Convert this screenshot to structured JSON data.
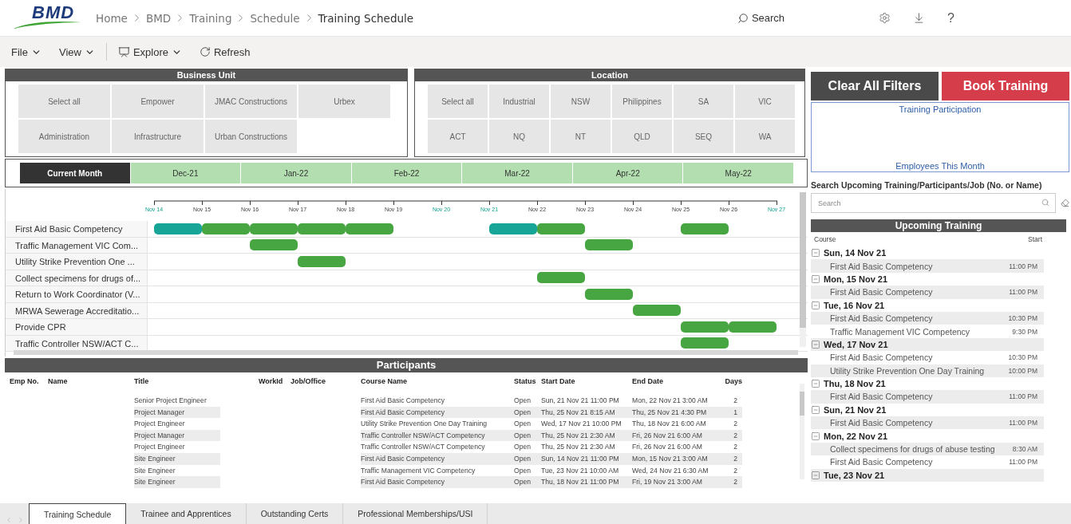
{
  "header": {
    "logo": "BMD",
    "breadcrumb": [
      "Home",
      "BMD",
      "Training",
      "Schedule",
      "Training Schedule"
    ],
    "search": "Search",
    "help": "?"
  },
  "toolbar": {
    "items": [
      "File",
      "View"
    ],
    "explore": "Explore",
    "refresh": "Refresh"
  },
  "business_unit": {
    "title": "Business Unit",
    "options": [
      {
        "label": "Select all",
        "selected": false
      },
      {
        "label": "Empower",
        "selected": false
      },
      {
        "label": "JMAC Constructions",
        "selected": false
      },
      {
        "label": "Urbex",
        "selected": false
      },
      {
        "label": "Administration",
        "selected": false
      },
      {
        "label": "Infrastructure",
        "selected": false
      },
      {
        "label": "Urban Constructions",
        "selected": false
      }
    ]
  },
  "location": {
    "title": "Location",
    "options": [
      {
        "label": "Select all",
        "selected": false
      },
      {
        "label": "Industrial",
        "selected": false
      },
      {
        "label": "NSW",
        "selected": false
      },
      {
        "label": "Philippines",
        "selected": false
      },
      {
        "label": "SA",
        "selected": false
      },
      {
        "label": "VIC",
        "selected": false
      },
      {
        "label": "ACT",
        "selected": false
      },
      {
        "label": "NQ",
        "selected": false
      },
      {
        "label": "NT",
        "selected": false
      },
      {
        "label": "QLD",
        "selected": false
      },
      {
        "label": "SEQ",
        "selected": false
      },
      {
        "label": "WA",
        "selected": false
      }
    ]
  },
  "months": [
    {
      "label": "Current Month",
      "selected": true
    },
    {
      "label": "Dec-21",
      "selected": false
    },
    {
      "label": "Jan-22",
      "selected": false
    },
    {
      "label": "Feb-22",
      "selected": false
    },
    {
      "label": "Mar-22",
      "selected": false
    },
    {
      "label": "Apr-22",
      "selected": false
    },
    {
      "label": "May-22",
      "selected": false
    }
  ],
  "gantt": {
    "ticks": [
      {
        "label": "Nov 14",
        "weekend": true
      },
      {
        "label": "Nov 15",
        "weekend": false
      },
      {
        "label": "Nov 16",
        "weekend": false
      },
      {
        "label": "Nov 17",
        "weekend": false
      },
      {
        "label": "Nov 18",
        "weekend": false
      },
      {
        "label": "Nov 19",
        "weekend": false
      },
      {
        "label": "Nov 20",
        "weekend": true
      },
      {
        "label": "Nov 21",
        "weekend": true
      },
      {
        "label": "Nov 22",
        "weekend": false
      },
      {
        "label": "Nov 23",
        "weekend": false
      },
      {
        "label": "Nov 24",
        "weekend": false
      },
      {
        "label": "Nov 25",
        "weekend": false
      },
      {
        "label": "Nov 26",
        "weekend": false
      },
      {
        "label": "Nov 27",
        "weekend": true
      }
    ],
    "rows": [
      {
        "course": "First Aid Basic Competency",
        "days": [
          {
            "kind": "highlight"
          },
          {
            "kind": "bar"
          },
          {
            "kind": "bar"
          },
          {
            "kind": "bar"
          },
          {
            "kind": "bar"
          },
          {
            "kind": "none"
          },
          {
            "kind": "none"
          },
          {
            "kind": "highlight"
          },
          {
            "kind": "bar"
          },
          {
            "kind": "none"
          },
          {
            "kind": "none"
          },
          {
            "kind": "bar"
          },
          {
            "kind": "none"
          }
        ]
      },
      {
        "course": "Traffic Management VIC Com...",
        "days": [
          {
            "kind": "none"
          },
          {
            "kind": "none"
          },
          {
            "kind": "bar"
          },
          {
            "kind": "none"
          },
          {
            "kind": "none"
          },
          {
            "kind": "none"
          },
          {
            "kind": "none"
          },
          {
            "kind": "none"
          },
          {
            "kind": "none"
          },
          {
            "kind": "bar"
          },
          {
            "kind": "none"
          },
          {
            "kind": "none"
          },
          {
            "kind": "none"
          }
        ]
      },
      {
        "course": "Utility Strike Prevention One ...",
        "days": [
          {
            "kind": "none"
          },
          {
            "kind": "none"
          },
          {
            "kind": "none"
          },
          {
            "kind": "bar"
          },
          {
            "kind": "none"
          },
          {
            "kind": "none"
          },
          {
            "kind": "none"
          },
          {
            "kind": "none"
          },
          {
            "kind": "none"
          },
          {
            "kind": "none"
          },
          {
            "kind": "none"
          },
          {
            "kind": "none"
          },
          {
            "kind": "none"
          }
        ]
      },
      {
        "course": "Collect specimens for drugs of...",
        "days": [
          {
            "kind": "none"
          },
          {
            "kind": "none"
          },
          {
            "kind": "none"
          },
          {
            "kind": "none"
          },
          {
            "kind": "none"
          },
          {
            "kind": "none"
          },
          {
            "kind": "none"
          },
          {
            "kind": "none"
          },
          {
            "kind": "bar"
          },
          {
            "kind": "none"
          },
          {
            "kind": "none"
          },
          {
            "kind": "none"
          },
          {
            "kind": "none"
          }
        ]
      },
      {
        "course": "Return to Work Coordinator (V...",
        "days": [
          {
            "kind": "none"
          },
          {
            "kind": "none"
          },
          {
            "kind": "none"
          },
          {
            "kind": "none"
          },
          {
            "kind": "none"
          },
          {
            "kind": "none"
          },
          {
            "kind": "none"
          },
          {
            "kind": "none"
          },
          {
            "kind": "none"
          },
          {
            "kind": "bar"
          },
          {
            "kind": "none"
          },
          {
            "kind": "none"
          },
          {
            "kind": "none"
          }
        ]
      },
      {
        "course": "MRWA Sewerage Accreditatio...",
        "days": [
          {
            "kind": "none"
          },
          {
            "kind": "none"
          },
          {
            "kind": "none"
          },
          {
            "kind": "none"
          },
          {
            "kind": "none"
          },
          {
            "kind": "none"
          },
          {
            "kind": "none"
          },
          {
            "kind": "none"
          },
          {
            "kind": "none"
          },
          {
            "kind": "none"
          },
          {
            "kind": "bar"
          },
          {
            "kind": "none"
          },
          {
            "kind": "none"
          }
        ]
      },
      {
        "course": "Provide CPR",
        "days": [
          {
            "kind": "none"
          },
          {
            "kind": "none"
          },
          {
            "kind": "none"
          },
          {
            "kind": "none"
          },
          {
            "kind": "none"
          },
          {
            "kind": "none"
          },
          {
            "kind": "none"
          },
          {
            "kind": "none"
          },
          {
            "kind": "none"
          },
          {
            "kind": "none"
          },
          {
            "kind": "none"
          },
          {
            "kind": "bar"
          },
          {
            "kind": "bar"
          }
        ]
      },
      {
        "course": "Traffic Controller NSW/ACT C...",
        "days": [
          {
            "kind": "none"
          },
          {
            "kind": "none"
          },
          {
            "kind": "none"
          },
          {
            "kind": "none"
          },
          {
            "kind": "none"
          },
          {
            "kind": "none"
          },
          {
            "kind": "none"
          },
          {
            "kind": "none"
          },
          {
            "kind": "none"
          },
          {
            "kind": "none"
          },
          {
            "kind": "none"
          },
          {
            "kind": "bar"
          },
          {
            "kind": "none"
          }
        ]
      }
    ]
  },
  "participants": {
    "title": "Participants",
    "columns": [
      "Emp No.",
      "Name",
      "Title",
      "WorkId",
      "Job/Office",
      "Course Name",
      "Status",
      "Start Date",
      "End Date",
      "Days"
    ],
    "rows": [
      {
        "title": "Senior Project Engineer",
        "course_name": "First Aid Basic Competency",
        "status": "Open",
        "start_date": "Sun, 21 Nov 21 11:00 PM",
        "end_date": "Mon, 22 Nov 21 3:00 AM",
        "days": "2"
      },
      {
        "title": "Project Manager",
        "course_name": "First Aid Basic Competency",
        "status": "Open",
        "start_date": "Thu, 25 Nov 21 8:15 AM",
        "end_date": "Thu, 25 Nov 21 4:30 PM",
        "days": "1"
      },
      {
        "title": "Project Engineer",
        "course_name": "Utility Strike Prevention One Day Training",
        "status": "Open",
        "start_date": "Wed, 17 Nov 21 10:00 PM",
        "end_date": "Thu, 18 Nov 21 6:00 AM",
        "days": "2"
      },
      {
        "title": "Project Manager",
        "course_name": "Traffic Controller NSW/ACT Competency",
        "status": "Open",
        "start_date": "Thu, 25 Nov 21 2:30 AM",
        "end_date": "Fri, 26 Nov 21 6:00 AM",
        "days": "2"
      },
      {
        "title": "Project Engineer",
        "course_name": "Traffic Controller NSW/ACT Competency",
        "status": "Open",
        "start_date": "Thu, 25 Nov 21 2:30 AM",
        "end_date": "Fri, 26 Nov 21 6:00 AM",
        "days": "2"
      },
      {
        "title": "Site Engineer",
        "course_name": "First Aid Basic Competency",
        "status": "Open",
        "start_date": "Sun, 14 Nov 21 11:00 PM",
        "end_date": "Mon, 15 Nov 21 3:00 AM",
        "days": "2"
      },
      {
        "title": "Site Engineer",
        "course_name": "Traffic Management VIC Competency",
        "status": "Open",
        "start_date": "Tue, 23 Nov 21 10:00 AM",
        "end_date": "Wed, 24 Nov 21 6:30 AM",
        "days": "2"
      },
      {
        "title": "Site Engineer",
        "course_name": "First Aid Basic Competency",
        "status": "Open",
        "start_date": "Thu, 18 Nov 21 11:00 PM",
        "end_date": "Fri, 19 Nov 21 3:00 AM",
        "days": "2"
      }
    ]
  },
  "actions": {
    "clear": "Clear All Filters",
    "book": "Book Training"
  },
  "participation": {
    "title": "Training Participation",
    "caption": "Employees This Month"
  },
  "search_panel": {
    "label": "Search Upcoming Training/Participants/Job (No. or Name)",
    "placeholder": "Search"
  },
  "upcoming": {
    "title": "Upcoming Training",
    "columns": [
      "Course",
      "Start"
    ],
    "groups": [
      {
        "date": "Sun, 14 Nov 21",
        "expanded": true,
        "items": [
          {
            "course": "First Aid Basic Competency",
            "start": "11:00 PM"
          }
        ]
      },
      {
        "date": "Mon, 15 Nov 21",
        "expanded": true,
        "items": [
          {
            "course": "First Aid Basic Competency",
            "start": "11:00 PM"
          }
        ]
      },
      {
        "date": "Tue, 16 Nov 21",
        "expanded": true,
        "items": [
          {
            "course": "First Aid Basic Competency",
            "start": "10:30 PM"
          },
          {
            "course": "Traffic Management VIC Competency",
            "start": "9:30 PM"
          }
        ]
      },
      {
        "date": "Wed, 17 Nov 21",
        "expanded": true,
        "items": [
          {
            "course": "First Aid Basic Competency",
            "start": "10:30 PM"
          },
          {
            "course": "Utility Strike Prevention One Day Training",
            "start": "10:00 PM"
          }
        ]
      },
      {
        "date": "Thu, 18 Nov 21",
        "expanded": true,
        "items": [
          {
            "course": "First Aid Basic Competency",
            "start": "11:00 PM"
          }
        ]
      },
      {
        "date": "Sun, 21 Nov 21",
        "expanded": true,
        "items": [
          {
            "course": "First Aid Basic Competency",
            "start": "11:00 PM"
          }
        ]
      },
      {
        "date": "Mon, 22 Nov 21",
        "expanded": true,
        "items": [
          {
            "course": "Collect specimens for drugs of abuse testing",
            "start": "8:30 AM"
          },
          {
            "course": "First Aid Basic Competency",
            "start": "11:00 PM"
          }
        ]
      },
      {
        "date": "Tue, 23 Nov 21",
        "expanded": true
      }
    ]
  },
  "tabs": [
    {
      "label": "Training Schedule",
      "selected": true
    },
    {
      "label": "Trainee and Apprentices",
      "selected": false
    },
    {
      "label": "Outstanding Certs",
      "selected": false
    },
    {
      "label": "Professional Memberships/USI",
      "selected": false
    }
  ]
}
